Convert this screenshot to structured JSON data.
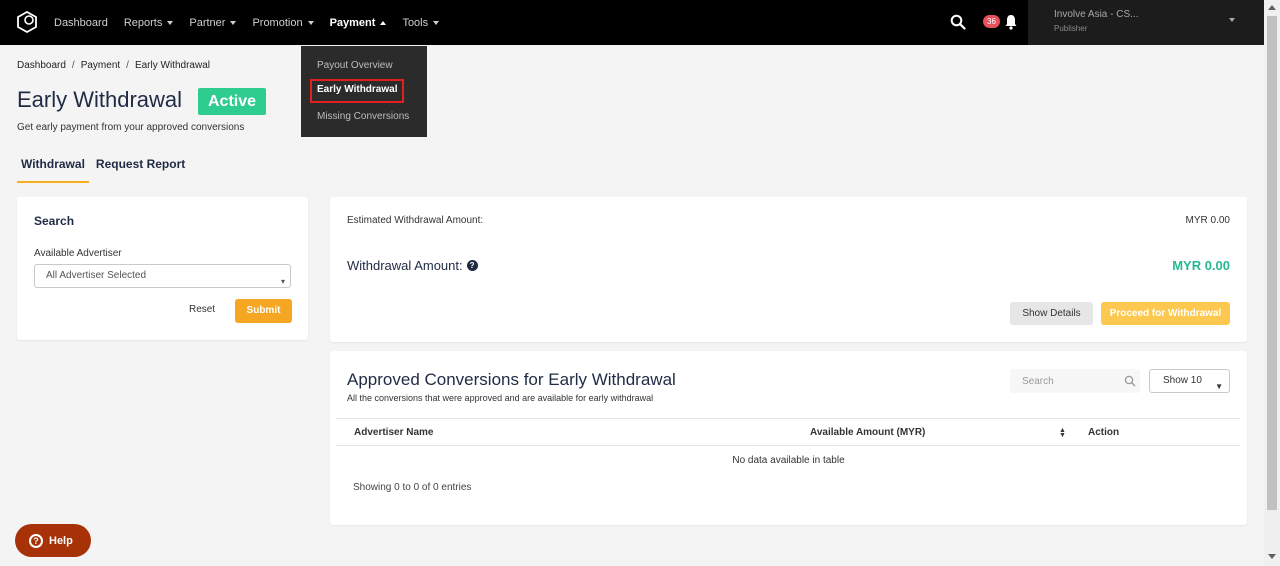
{
  "nav": {
    "items": [
      {
        "label": "Dashboard",
        "has_caret": false
      },
      {
        "label": "Reports",
        "has_caret": true
      },
      {
        "label": "Partner",
        "has_caret": true
      },
      {
        "label": "Promotion",
        "has_caret": true
      },
      {
        "label": "Payment",
        "has_caret": true
      },
      {
        "label": "Tools",
        "has_caret": true
      }
    ],
    "notification_count": "36",
    "account_name": "Involve Asia - CS...",
    "account_role": "Publisher"
  },
  "payment_menu": {
    "items": [
      "Payout Overview",
      "Early Withdrawal",
      "Missing Conversions"
    ]
  },
  "breadcrumb": {
    "items": [
      "Dashboard",
      "Payment",
      "Early Withdrawal"
    ],
    "separator": "/"
  },
  "page": {
    "title": "Early Withdrawal",
    "status": "Active",
    "subtitle": "Get early payment from your approved conversions"
  },
  "tabs": [
    "Withdrawal",
    "Request Report"
  ],
  "search_card": {
    "title": "Search",
    "advertiser_label": "Available Advertiser",
    "advertiser_value": "All Advertiser Selected",
    "reset_label": "Reset",
    "submit_label": "Submit"
  },
  "withdrawal": {
    "estimated_label": "Estimated Withdrawal Amount:",
    "estimated_value": "MYR 0.00",
    "amount_label": "Withdrawal Amount:",
    "amount_value": "MYR 0.00",
    "details_label": "Show Details",
    "proceed_label": "Proceed for Withdrawal"
  },
  "table": {
    "title": "Approved Conversions for Early Withdrawal",
    "subtitle": "All the conversions that were approved and are available for early withdrawal",
    "search_placeholder": "Search",
    "show_value": "Show 10",
    "columns": [
      "Advertiser Name",
      "Available Amount (MYR)",
      "Action"
    ],
    "empty_message": "No data available in table",
    "info": "Showing 0 to 0 of 0 entries"
  },
  "help_label": "Help",
  "colors": {
    "status_active": "#2ecc8f",
    "submit": "#f5a623",
    "amount": "#26b890",
    "help_button": "#a83208",
    "highlight_box": "#e02020"
  }
}
